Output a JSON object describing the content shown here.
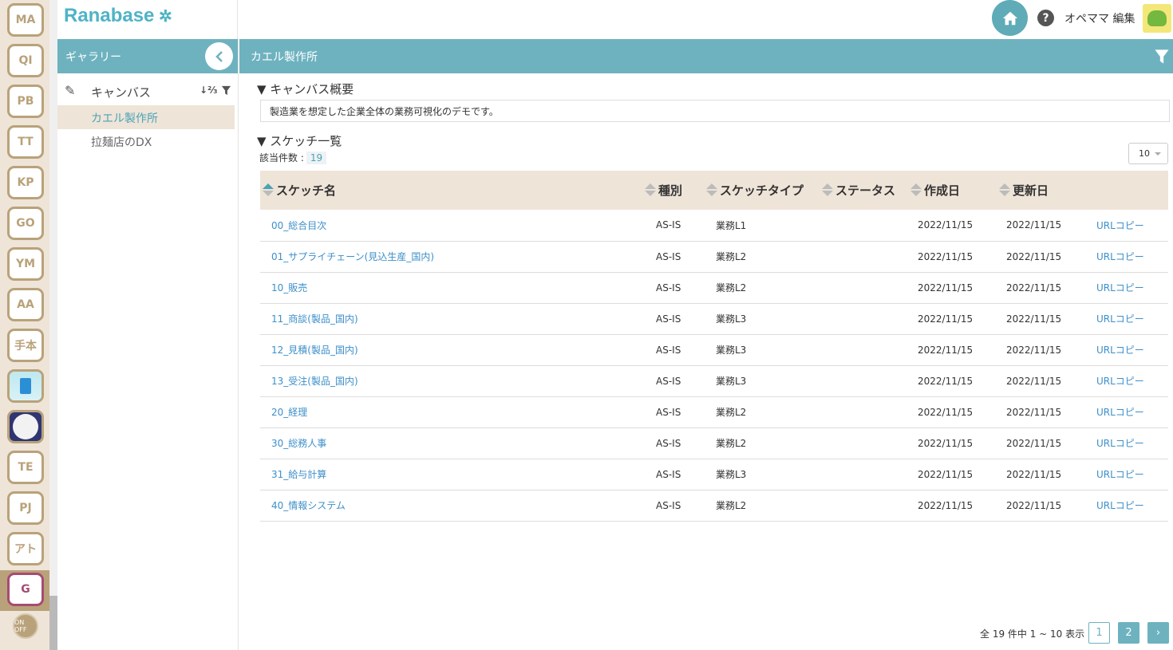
{
  "header": {
    "logo": "Ranabase",
    "user_name": "オペママ 編集"
  },
  "rail": {
    "workspaces": [
      "MA",
      "QI",
      "PB",
      "TT",
      "KP",
      "GO",
      "YM",
      "AA",
      "手本",
      "",
      "",
      "TE",
      "PJ",
      "アト",
      "G"
    ],
    "onoff": "ON OFF"
  },
  "sidebar": {
    "title": "ギャラリー",
    "section": "キャンバス",
    "items": [
      {
        "label": "カエル製作所",
        "active": true
      },
      {
        "label": "拉麺店のDX",
        "active": false
      }
    ]
  },
  "main": {
    "title": "カエル製作所",
    "summary_title": "▼ キャンバス概要",
    "summary_text": "製造業を想定した企業全体の業務可視化のデモです。",
    "list_title": "▼ スケッチ一覧",
    "count_label": "該当件数 :",
    "count_value": "19",
    "per_page": "10",
    "columns": [
      "スケッチ名",
      "種別",
      "スケッチタイプ",
      "ステータス",
      "作成日",
      "更新日"
    ],
    "rows": [
      {
        "name": "00_総合目次",
        "kind": "AS-IS",
        "type": "業務L1",
        "status": "",
        "created": "2022/11/15",
        "updated": "2022/11/15",
        "copy": "URLコピー"
      },
      {
        "name": "01_サプライチェーン(見込生産_国内)",
        "kind": "AS-IS",
        "type": "業務L2",
        "status": "",
        "created": "2022/11/15",
        "updated": "2022/11/15",
        "copy": "URLコピー"
      },
      {
        "name": "10_販売",
        "kind": "AS-IS",
        "type": "業務L2",
        "status": "",
        "created": "2022/11/15",
        "updated": "2022/11/15",
        "copy": "URLコピー"
      },
      {
        "name": "11_商談(製品_国内)",
        "kind": "AS-IS",
        "type": "業務L3",
        "status": "",
        "created": "2022/11/15",
        "updated": "2022/11/15",
        "copy": "URLコピー"
      },
      {
        "name": "12_見積(製品_国内)",
        "kind": "AS-IS",
        "type": "業務L3",
        "status": "",
        "created": "2022/11/15",
        "updated": "2022/11/15",
        "copy": "URLコピー"
      },
      {
        "name": "13_受注(製品_国内)",
        "kind": "AS-IS",
        "type": "業務L3",
        "status": "",
        "created": "2022/11/15",
        "updated": "2022/11/15",
        "copy": "URLコピー"
      },
      {
        "name": "20_経理",
        "kind": "AS-IS",
        "type": "業務L2",
        "status": "",
        "created": "2022/11/15",
        "updated": "2022/11/15",
        "copy": "URLコピー"
      },
      {
        "name": "30_総務人事",
        "kind": "AS-IS",
        "type": "業務L2",
        "status": "",
        "created": "2022/11/15",
        "updated": "2022/11/15",
        "copy": "URLコピー"
      },
      {
        "name": "31_給与計算",
        "kind": "AS-IS",
        "type": "業務L3",
        "status": "",
        "created": "2022/11/15",
        "updated": "2022/11/15",
        "copy": "URLコピー"
      },
      {
        "name": "40_情報システム",
        "kind": "AS-IS",
        "type": "業務L2",
        "status": "",
        "created": "2022/11/15",
        "updated": "2022/11/15",
        "copy": "URLコピー"
      }
    ],
    "pager_text": "全 19 件中 1 ~ 10 表示",
    "pages": [
      "1",
      "2"
    ],
    "next": "›"
  },
  "colors": {
    "accent": "#6eb2bf",
    "beige": "#efe4d8",
    "link": "#3d8fc9",
    "rail_border": "#b9a27a"
  }
}
